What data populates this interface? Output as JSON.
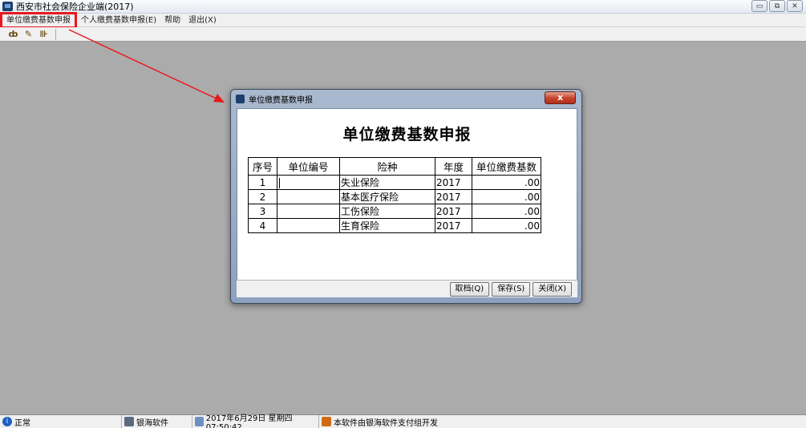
{
  "window": {
    "title": "西安市社会保险企业端(2017)",
    "controls": {
      "minimize": "▭",
      "restore": "⧉",
      "close": "✕"
    }
  },
  "menu": {
    "items": [
      {
        "label": "单位缴费基数申报",
        "highlighted": true
      },
      {
        "label": "个人缴费基数申报(E)"
      },
      {
        "label": "帮助"
      },
      {
        "label": "退出(X)"
      }
    ]
  },
  "toolbar": {
    "icons": [
      "sound-icon",
      "edit-icon",
      "exit-door-icon"
    ],
    "glyphs": [
      "ȸ",
      "✎",
      "⊪"
    ]
  },
  "annotation": {
    "color": "#e8191e"
  },
  "dialog": {
    "title": "单位缴费基数申报",
    "close_glyph": "x",
    "heading": "单位缴费基数申报",
    "table": {
      "headers": [
        "序号",
        "单位编号",
        "险种",
        "年度",
        "单位缴费基数"
      ],
      "rows": [
        {
          "seq": "1",
          "unit": "",
          "type": "失业保险",
          "year": "2017",
          "base": ".00"
        },
        {
          "seq": "2",
          "unit": "",
          "type": "基本医疗保险",
          "year": "2017",
          "base": ".00"
        },
        {
          "seq": "3",
          "unit": "",
          "type": "工伤保险",
          "year": "2017",
          "base": ".00"
        },
        {
          "seq": "4",
          "unit": "",
          "type": "生育保险",
          "year": "2017",
          "base": ".00"
        }
      ]
    },
    "buttons": {
      "cancel": "取档(Q)",
      "save": "保存(S)",
      "close": "关闭(X)"
    }
  },
  "status": {
    "state": "正常",
    "company": "银海软件",
    "datetime": "2017年6月29日 星期四 07:50:42",
    "credit": "本软件由银海软件支付组开发"
  }
}
